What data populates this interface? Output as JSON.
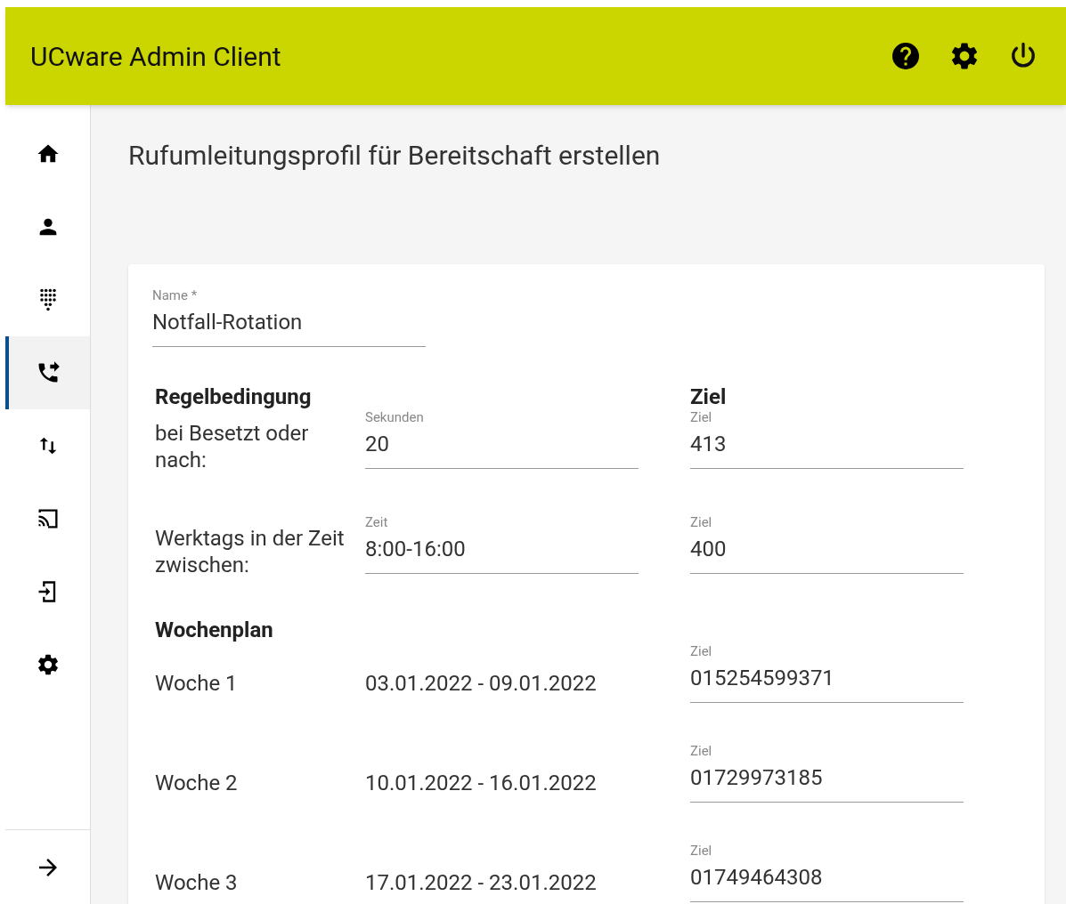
{
  "header": {
    "title": "UCware Admin Client"
  },
  "sidebar": {
    "items": [
      {
        "selected": false
      },
      {
        "selected": false
      },
      {
        "selected": false
      },
      {
        "selected": true
      },
      {
        "selected": false
      },
      {
        "selected": false
      },
      {
        "selected": false
      },
      {
        "selected": false
      }
    ]
  },
  "page_title": "Rufumleitungsprofil für Bereitschaft erstellen",
  "form": {
    "name_field": {
      "label": "Name *",
      "value": "Notfall-Rotation"
    },
    "rules_heading": "Regelbedingung",
    "target_heading": "Ziel",
    "rules": [
      {
        "label": "bei Besetzt oder nach:",
        "field": {
          "label": "Sekunden",
          "value": "20"
        },
        "target": {
          "label": "Ziel",
          "value": "413"
        }
      },
      {
        "label": "Werktags in der Zeit zwischen:",
        "field": {
          "label": "Zeit",
          "value": "8:00-16:00"
        },
        "target": {
          "label": "Ziel",
          "value": "400"
        }
      }
    ],
    "schedule_heading": "Wochenplan",
    "weeks": [
      {
        "week": "Woche 1",
        "range": "03.01.2022 - 09.01.2022",
        "target": {
          "label": "Ziel",
          "value": "015254599371"
        }
      },
      {
        "week": "Woche 2",
        "range": "10.01.2022 - 16.01.2022",
        "target": {
          "label": "Ziel",
          "value": "01729973185"
        }
      },
      {
        "week": "Woche 3",
        "range": "17.01.2022 - 23.01.2022",
        "target": {
          "label": "Ziel",
          "value": "01749464308"
        }
      }
    ]
  }
}
